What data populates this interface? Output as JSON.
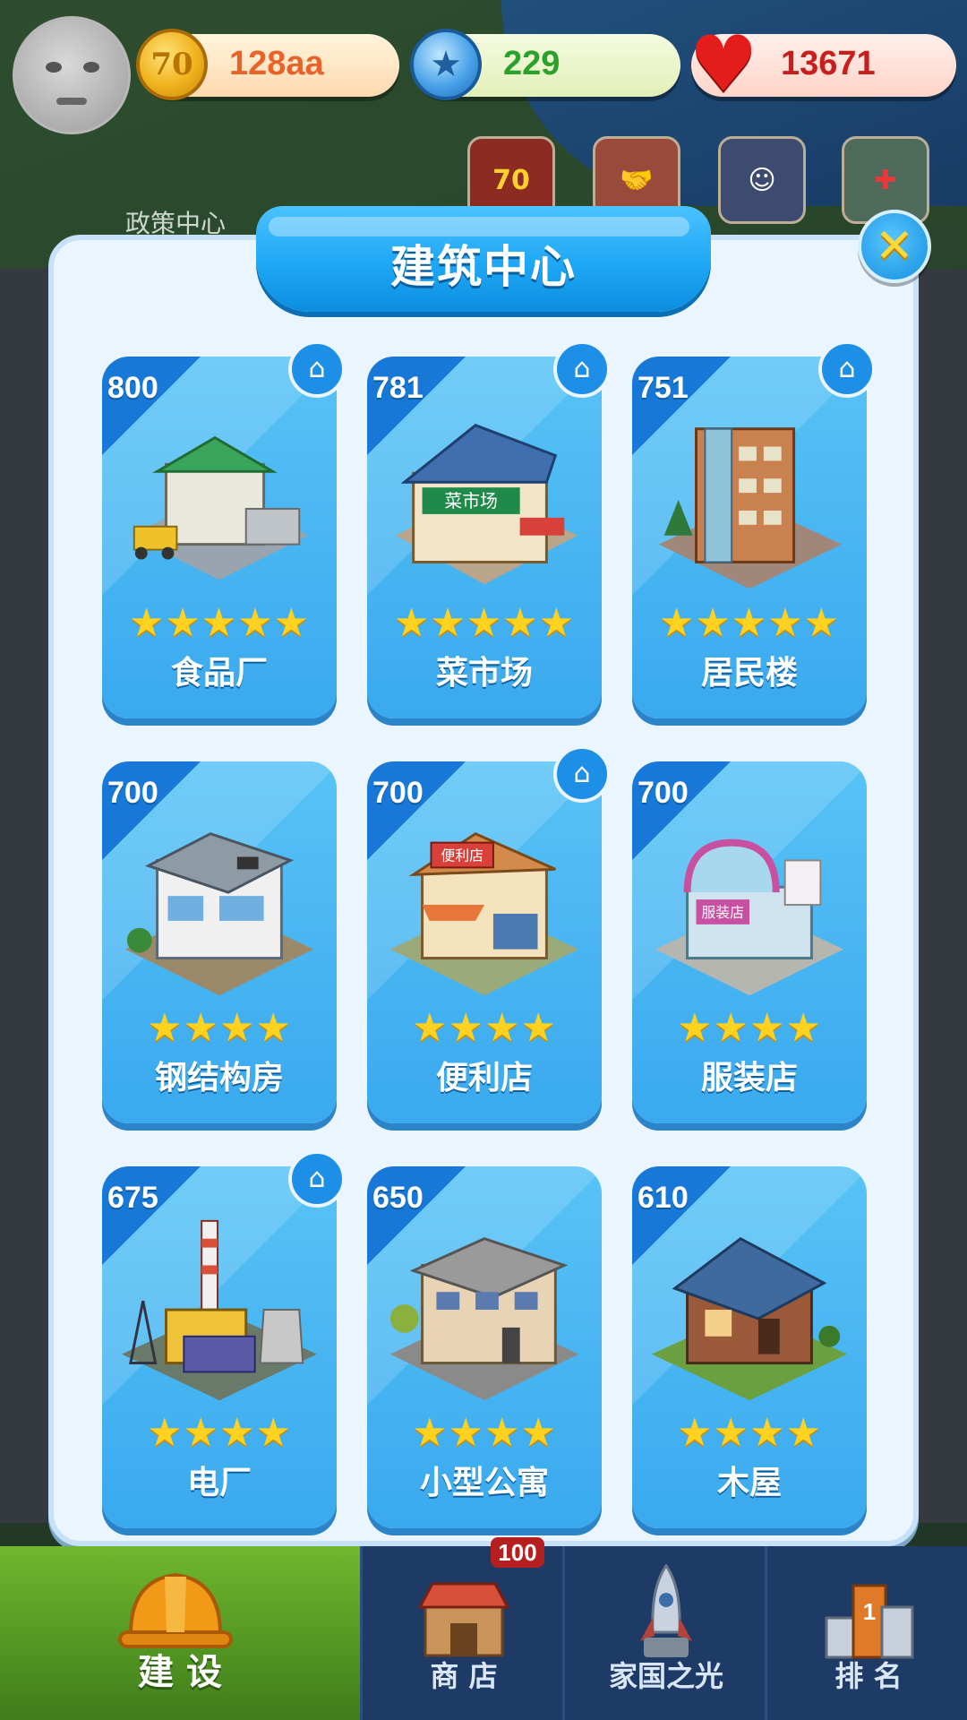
{
  "hud": {
    "coins": "128aa",
    "coin_icon_glyph": "70",
    "gems": "229",
    "hearts": "13671",
    "coin_color": "#e8632a",
    "gem_color": "#2aa12a",
    "heart_color": "#c81e1e"
  },
  "event_icons": [
    {
      "name": "event-70-icon",
      "glyph": "70"
    },
    {
      "name": "handshake-event-icon",
      "glyph": "🤝"
    },
    {
      "name": "character-event-icon",
      "glyph": "☺"
    },
    {
      "name": "medical-event-icon",
      "glyph": "✚"
    }
  ],
  "map": {
    "policy_label": "政策中心"
  },
  "panel": {
    "title": "建筑中心",
    "close_glyph": "✕",
    "buildings": [
      {
        "value": "800",
        "name": "食品厂",
        "stars": 5,
        "home": true
      },
      {
        "value": "781",
        "name": "菜市场",
        "stars": 5,
        "home": true
      },
      {
        "value": "751",
        "name": "居民楼",
        "stars": 5,
        "home": true
      },
      {
        "value": "700",
        "name": "钢结构房",
        "stars": 4,
        "home": false
      },
      {
        "value": "700",
        "name": "便利店",
        "stars": 4,
        "home": true
      },
      {
        "value": "700",
        "name": "服装店",
        "stars": 4,
        "home": false
      },
      {
        "value": "675",
        "name": "电厂",
        "stars": 4,
        "home": true
      },
      {
        "value": "650",
        "name": "小型公寓",
        "stars": 4,
        "home": false
      },
      {
        "value": "610",
        "name": "木屋",
        "stars": 4,
        "home": false
      }
    ],
    "building_signs": {
      "market": "菜市场",
      "store": "便利店",
      "clothes": "服装店"
    }
  },
  "nav": {
    "tabs": [
      {
        "label": "建 设",
        "active": true
      },
      {
        "label": "商 店",
        "active": false
      },
      {
        "label": "家国之光",
        "active": false
      },
      {
        "label": "排 名",
        "active": false
      }
    ],
    "shop_badge": "100"
  }
}
